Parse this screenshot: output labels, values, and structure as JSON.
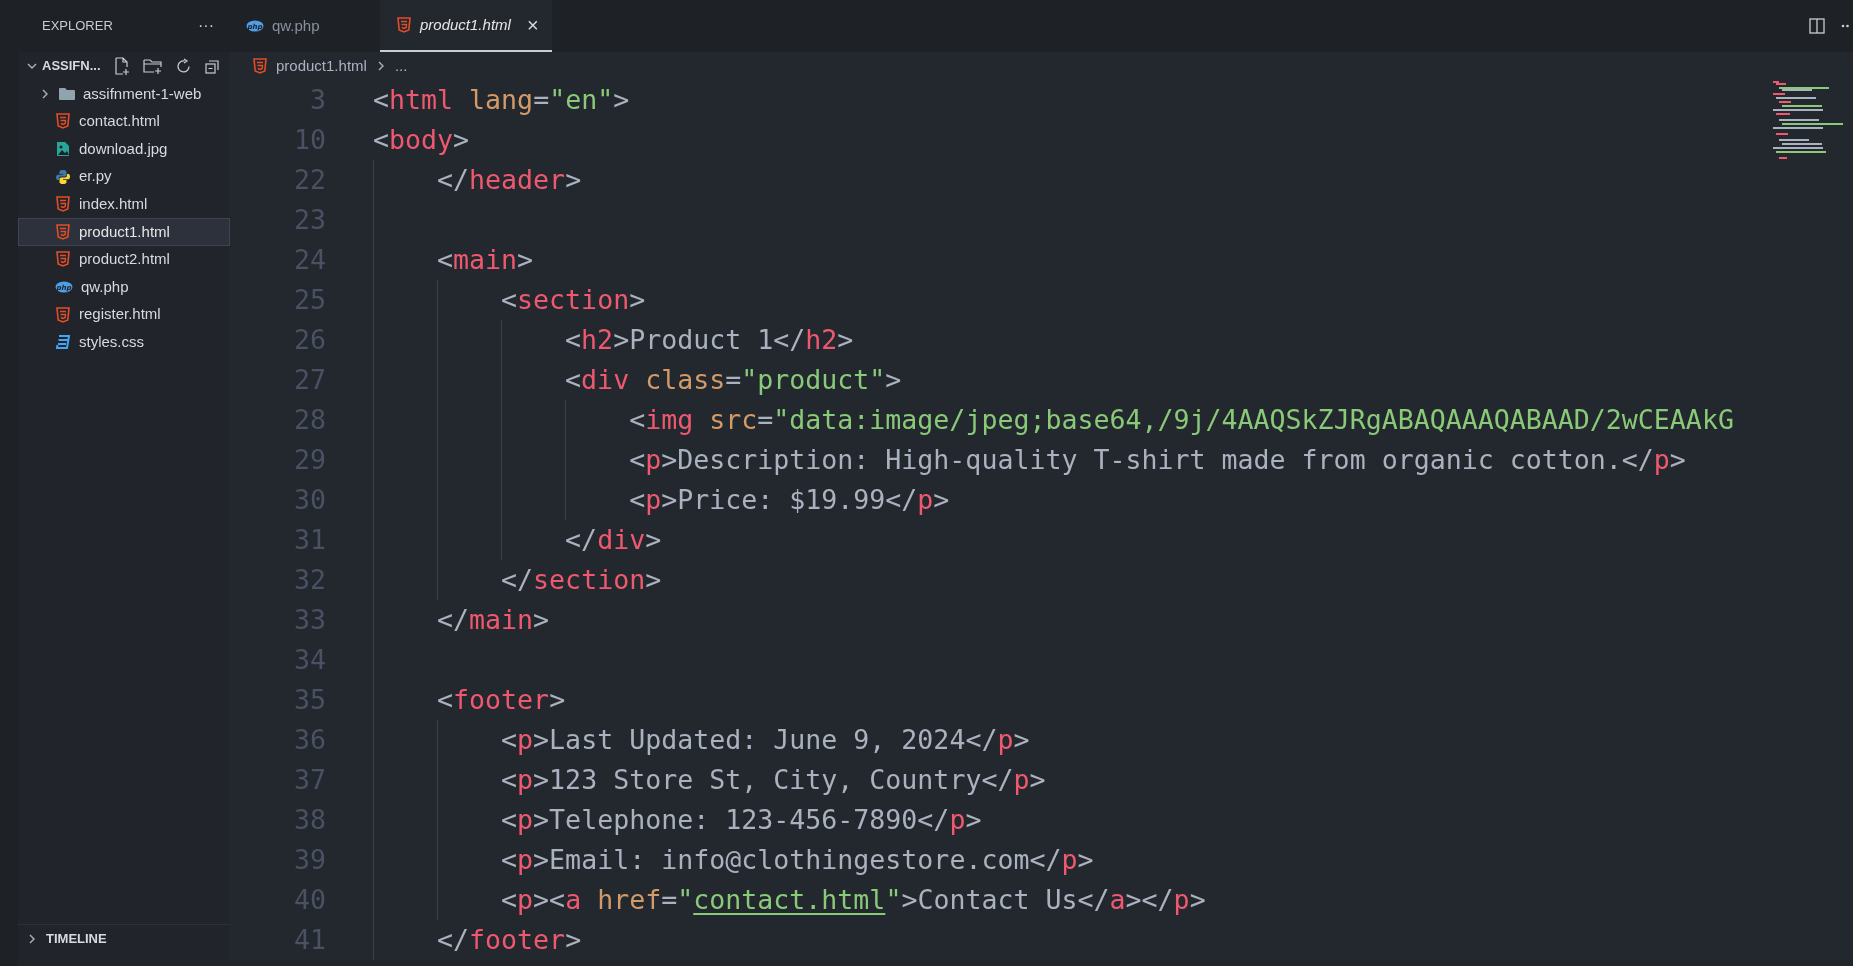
{
  "sidebar": {
    "title": "EXPLORER",
    "more": "···",
    "folder": {
      "label": "ASSIFN...",
      "expanded": true
    },
    "items": [
      {
        "label": "assifnment-1-web",
        "kind": "folder",
        "expanded": false,
        "selected": false
      },
      {
        "label": "contact.html",
        "kind": "html",
        "selected": false
      },
      {
        "label": "download.jpg",
        "kind": "image",
        "selected": false
      },
      {
        "label": "er.py",
        "kind": "python",
        "selected": false
      },
      {
        "label": "index.html",
        "kind": "html",
        "selected": false
      },
      {
        "label": "product1.html",
        "kind": "html",
        "selected": true
      },
      {
        "label": "product2.html",
        "kind": "html",
        "selected": false
      },
      {
        "label": "qw.php",
        "kind": "php",
        "selected": false
      },
      {
        "label": "register.html",
        "kind": "html",
        "selected": false
      },
      {
        "label": "styles.css",
        "kind": "css",
        "selected": false
      }
    ],
    "timeline": {
      "label": "TIMELINE",
      "expanded": false
    }
  },
  "tabs": [
    {
      "label": "qw.php",
      "kind": "php",
      "selected": false
    },
    {
      "label": "product1.html",
      "kind": "html",
      "selected": true,
      "close": "×"
    }
  ],
  "breadcrumb": {
    "file": "product1.html",
    "rest": "..."
  },
  "code": [
    {
      "n": "3",
      "tokens": [
        {
          "kind": "punct",
          "text": "<"
        },
        {
          "kind": "tag",
          "text": "html "
        },
        {
          "kind": "attr",
          "text": "lang"
        },
        {
          "kind": "punct",
          "text": "="
        },
        {
          "kind": "string",
          "text": "\"en\""
        },
        {
          "kind": "punct",
          "text": ">"
        }
      ]
    },
    {
      "n": "10",
      "tokens": [
        {
          "kind": "punct",
          "text": "<"
        },
        {
          "kind": "tag",
          "text": "body"
        },
        {
          "kind": "punct",
          "text": ">"
        }
      ],
      "children": [
        {
          "n": "22",
          "tokens": [
            {
              "kind": "punct",
              "text": "</"
            },
            {
              "kind": "tag",
              "text": "header"
            },
            {
              "kind": "punct",
              "text": ">"
            }
          ]
        },
        {
          "n": "23"
        },
        {
          "n": "24",
          "tokens": [
            {
              "kind": "punct",
              "text": "<"
            },
            {
              "kind": "tag",
              "text": "main"
            },
            {
              "kind": "punct",
              "text": ">"
            }
          ],
          "children": [
            {
              "n": "25",
              "tokens": [
                {
                  "kind": "punct",
                  "text": "<"
                },
                {
                  "kind": "tag",
                  "text": "section"
                },
                {
                  "kind": "punct",
                  "text": ">"
                }
              ],
              "children": [
                {
                  "n": "26",
                  "tokens": [
                    {
                      "kind": "punct",
                      "text": "<"
                    },
                    {
                      "kind": "tag",
                      "text": "h2"
                    },
                    {
                      "kind": "punct",
                      "text": ">"
                    },
                    {
                      "kind": "text",
                      "text": "Product 1"
                    },
                    {
                      "kind": "punct",
                      "text": "</"
                    },
                    {
                      "kind": "tag",
                      "text": "h2"
                    },
                    {
                      "kind": "punct",
                      "text": ">"
                    }
                  ]
                },
                {
                  "n": "27",
                  "tokens": [
                    {
                      "kind": "punct",
                      "text": "<"
                    },
                    {
                      "kind": "tag",
                      "text": "div "
                    },
                    {
                      "kind": "attr",
                      "text": "class"
                    },
                    {
                      "kind": "punct",
                      "text": "="
                    },
                    {
                      "kind": "string",
                      "text": "\"product\""
                    },
                    {
                      "kind": "punct",
                      "text": ">"
                    }
                  ],
                  "children": [
                    {
                      "n": "28",
                      "tokens": [
                        {
                          "kind": "punct",
                          "text": "<"
                        },
                        {
                          "kind": "tag",
                          "text": "img "
                        },
                        {
                          "kind": "attr",
                          "text": "src"
                        },
                        {
                          "kind": "punct",
                          "text": "="
                        },
                        {
                          "kind": "string",
                          "text": "\"data:image/jpeg;base64,/9j/4AAQSkZJRgABAQAAAQABAAD/2wCEAAkG"
                        }
                      ]
                    },
                    {
                      "n": "29",
                      "tokens": [
                        {
                          "kind": "punct",
                          "text": "<"
                        },
                        {
                          "kind": "tag",
                          "text": "p"
                        },
                        {
                          "kind": "punct",
                          "text": ">"
                        },
                        {
                          "kind": "text",
                          "text": "Description: High-quality T-shirt made from organic cotton."
                        },
                        {
                          "kind": "punct",
                          "text": "</"
                        },
                        {
                          "kind": "tag",
                          "text": "p"
                        },
                        {
                          "kind": "punct",
                          "text": ">"
                        }
                      ]
                    },
                    {
                      "n": "30",
                      "tokens": [
                        {
                          "kind": "punct",
                          "text": "<"
                        },
                        {
                          "kind": "tag",
                          "text": "p"
                        },
                        {
                          "kind": "punct",
                          "text": ">"
                        },
                        {
                          "kind": "text",
                          "text": "Price: $19.99"
                        },
                        {
                          "kind": "punct",
                          "text": "</"
                        },
                        {
                          "kind": "tag",
                          "text": "p"
                        },
                        {
                          "kind": "punct",
                          "text": ">"
                        }
                      ]
                    }
                  ]
                },
                {
                  "n": "31",
                  "tokens": [
                    {
                      "kind": "punct",
                      "text": "</"
                    },
                    {
                      "kind": "tag",
                      "text": "div"
                    },
                    {
                      "kind": "punct",
                      "text": ">"
                    }
                  ]
                }
              ]
            },
            {
              "n": "32",
              "tokens": [
                {
                  "kind": "punct",
                  "text": "</"
                },
                {
                  "kind": "tag",
                  "text": "section"
                },
                {
                  "kind": "punct",
                  "text": ">"
                }
              ]
            }
          ]
        },
        {
          "n": "33",
          "tokens": [
            {
              "kind": "punct",
              "text": "</"
            },
            {
              "kind": "tag",
              "text": "main"
            },
            {
              "kind": "punct",
              "text": ">"
            }
          ]
        },
        {
          "n": "34"
        },
        {
          "n": "35",
          "tokens": [
            {
              "kind": "punct",
              "text": "<"
            },
            {
              "kind": "tag",
              "text": "footer"
            },
            {
              "kind": "punct",
              "text": ">"
            }
          ],
          "children": [
            {
              "n": "36",
              "tokens": [
                {
                  "kind": "punct",
                  "text": "<"
                },
                {
                  "kind": "tag",
                  "text": "p"
                },
                {
                  "kind": "punct",
                  "text": ">"
                },
                {
                  "kind": "text",
                  "text": "Last Updated: June 9, 2024"
                },
                {
                  "kind": "punct",
                  "text": "</"
                },
                {
                  "kind": "tag",
                  "text": "p"
                },
                {
                  "kind": "punct",
                  "text": ">"
                }
              ]
            },
            {
              "n": "37",
              "tokens": [
                {
                  "kind": "punct",
                  "text": "<"
                },
                {
                  "kind": "tag",
                  "text": "p"
                },
                {
                  "kind": "punct",
                  "text": ">"
                },
                {
                  "kind": "text",
                  "text": "123 Store St, City, Country"
                },
                {
                  "kind": "punct",
                  "text": "</"
                },
                {
                  "kind": "tag",
                  "text": "p"
                },
                {
                  "kind": "punct",
                  "text": ">"
                }
              ]
            },
            {
              "n": "38",
              "tokens": [
                {
                  "kind": "punct",
                  "text": "<"
                },
                {
                  "kind": "tag",
                  "text": "p"
                },
                {
                  "kind": "punct",
                  "text": ">"
                },
                {
                  "kind": "text",
                  "text": "Telephone: 123-456-7890"
                },
                {
                  "kind": "punct",
                  "text": "</"
                },
                {
                  "kind": "tag",
                  "text": "p"
                },
                {
                  "kind": "punct",
                  "text": ">"
                }
              ]
            },
            {
              "n": "39",
              "tokens": [
                {
                  "kind": "punct",
                  "text": "<"
                },
                {
                  "kind": "tag",
                  "text": "p"
                },
                {
                  "kind": "punct",
                  "text": ">"
                },
                {
                  "kind": "text",
                  "text": "Email: info@clothingestore.com"
                },
                {
                  "kind": "punct",
                  "text": "</"
                },
                {
                  "kind": "tag",
                  "text": "p"
                },
                {
                  "kind": "punct",
                  "text": ">"
                }
              ]
            },
            {
              "n": "40",
              "tokens": [
                {
                  "kind": "punct",
                  "text": "<"
                },
                {
                  "kind": "tag",
                  "text": "p"
                },
                {
                  "kind": "punct",
                  "text": "><"
                },
                {
                  "kind": "tag",
                  "text": "a "
                },
                {
                  "kind": "attr",
                  "text": "href"
                },
                {
                  "kind": "punct",
                  "text": "="
                },
                {
                  "kind": "string",
                  "text": "\""
                },
                {
                  "kind": "link",
                  "text": "contact.html"
                },
                {
                  "kind": "string",
                  "text": "\""
                },
                {
                  "kind": "punct",
                  "text": ">"
                },
                {
                  "kind": "text",
                  "text": "Contact Us"
                },
                {
                  "kind": "punct",
                  "text": "</"
                },
                {
                  "kind": "tag",
                  "text": "a"
                },
                {
                  "kind": "punct",
                  "text": "></"
                },
                {
                  "kind": "tag",
                  "text": "p"
                },
                {
                  "kind": "punct",
                  "text": ">"
                }
              ]
            }
          ]
        },
        {
          "n": "41",
          "tokens": [
            {
              "kind": "punct",
              "text": "</"
            },
            {
              "kind": "tag",
              "text": "footer"
            },
            {
              "kind": "punct",
              "text": ">"
            }
          ]
        }
      ]
    }
  ]
}
